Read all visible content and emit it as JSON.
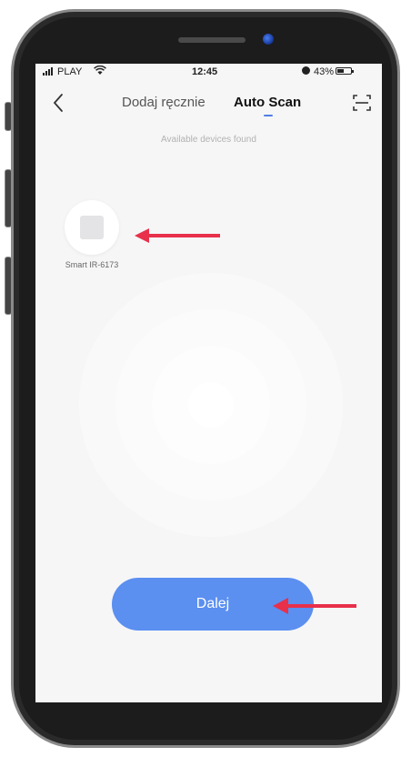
{
  "status_bar": {
    "carrier": "PLAY",
    "time": "12:45",
    "battery_percent": "43%"
  },
  "nav": {
    "tab_manual": "Dodaj ręcznie",
    "tab_auto": "Auto Scan",
    "active_tab": "Auto Scan"
  },
  "scan": {
    "subtitle": "Available devices found"
  },
  "devices": [
    {
      "label": "Smart IR-6173",
      "icon": "device-placeholder-icon"
    }
  ],
  "actions": {
    "next_label": "Dalej"
  },
  "colors": {
    "accent": "#5b8ff0",
    "annotation_arrow": "#e8304a",
    "screen_background": "#f6f6f7"
  }
}
